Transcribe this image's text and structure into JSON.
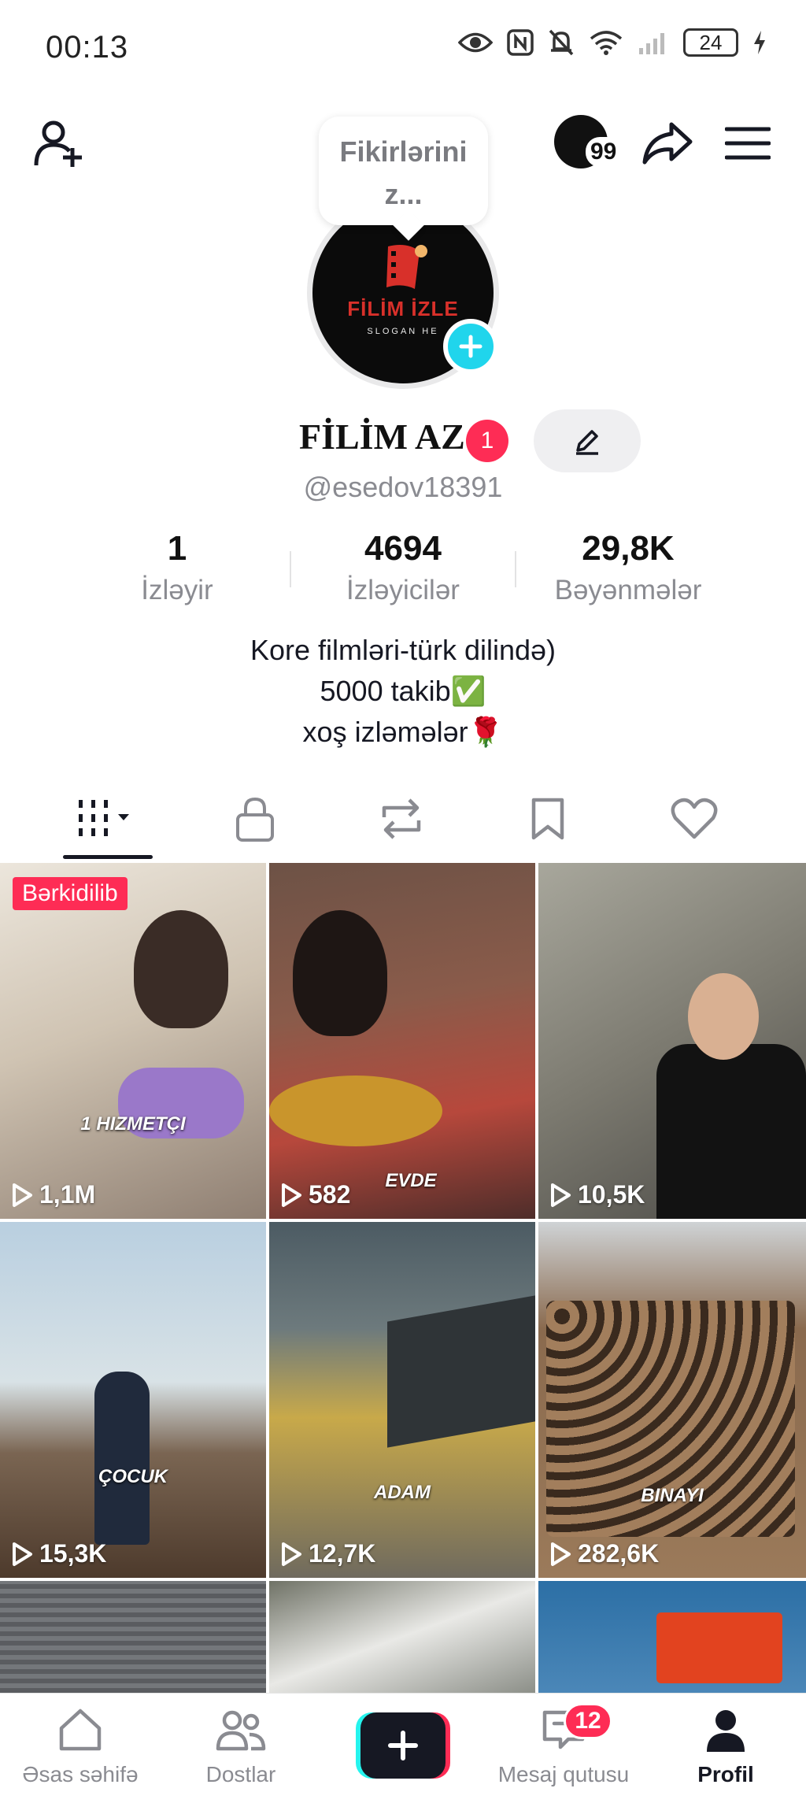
{
  "status_bar": {
    "time": "00:13",
    "battery": "24",
    "icons": [
      "eye-icon",
      "nfc-icon",
      "mute-icon",
      "wifi-icon",
      "signal-icon",
      "charging-icon"
    ]
  },
  "header": {
    "add_friend_icon": "person-plus-icon",
    "views_badge": "99",
    "share_icon": "share-icon",
    "menu_icon": "hamburger-icon"
  },
  "profile": {
    "bubble_text_1": "Fikirlərini",
    "bubble_text_2": "z...",
    "logo_title": "FİLİM İZLE",
    "logo_subtitle": "SLOGAN HE",
    "display_name": "FİLİM AZ",
    "notification_count": "1",
    "username": "@esedov18391"
  },
  "stats": [
    {
      "value": "1",
      "label": "İzləyir"
    },
    {
      "value": "4694",
      "label": "İzləyicilər"
    },
    {
      "value": "29,8K",
      "label": "Bəyənmələr"
    }
  ],
  "bio": {
    "line1": "Kore filmləri-türk dilində)",
    "line2": "5000 takib✅",
    "line3": "xoş izləmələr🌹"
  },
  "tabs": [
    "videos-grid-icon",
    "lock-icon",
    "repost-icon",
    "bookmark-icon",
    "heart-icon"
  ],
  "videos": [
    {
      "views": "1,1M",
      "caption": "1 HIZMETÇI",
      "pinned": "Bərkidilib",
      "bg": "#c9c1b3"
    },
    {
      "views": "582",
      "caption": "EVDE",
      "bg": "#7d4a3d"
    },
    {
      "views": "10,5K",
      "caption": "",
      "bg": "#8d8f86"
    },
    {
      "views": "15,3K",
      "caption": "ÇOCUK",
      "bg": "#9bb3c8"
    },
    {
      "views": "12,7K",
      "caption": "ADAM",
      "bg": "#5b6a73"
    },
    {
      "views": "282,6K",
      "caption": "BINAYI",
      "bg": "#8a6a4e"
    },
    {
      "views": "",
      "caption": "",
      "bg": "#6d6f72"
    },
    {
      "views": "",
      "caption": "",
      "bg": "#9c9f99"
    },
    {
      "views": "",
      "caption": "",
      "bg": "#2d6fa6"
    }
  ],
  "bottom_nav": {
    "home": "Əsas səhifə",
    "friends": "Dostlar",
    "inbox": "Mesaj qutusu",
    "inbox_badge": "12",
    "profile": "Profil"
  }
}
